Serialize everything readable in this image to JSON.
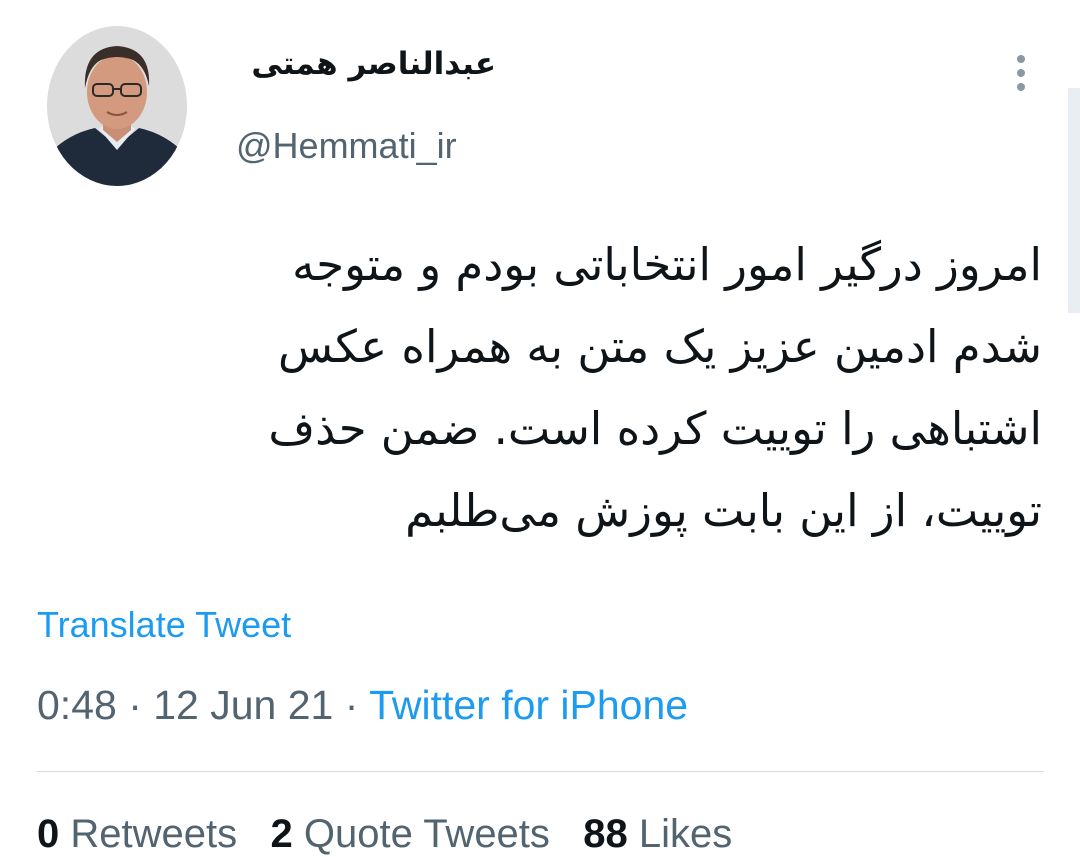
{
  "user": {
    "display_name": "عبدالناصر همتی",
    "handle": "@Hemmati_ir",
    "avatar_icon": "profile-photo"
  },
  "more_icon": "vertical-ellipsis-icon",
  "tweet": {
    "lines": [
      "امروز درگیر امور انتخاباتی بودم و متوجه",
      "شدم ادمین عزیز یک متن به همراه عکس",
      "اشتباهی را توییت کرده است. ضمن حذف",
      "توییت، از این بابت پوزش می‌طلبم"
    ]
  },
  "translate_label": "Translate Tweet",
  "meta": {
    "time": "0:48",
    "date": "12 Jun 21",
    "separator": " · ",
    "source": "Twitter for iPhone"
  },
  "stats": {
    "retweets_count": "0",
    "retweets_label": "Retweets",
    "quote_count": "2",
    "quote_label": "Quote Tweets",
    "likes_count": "88",
    "likes_label": "Likes"
  },
  "colors": {
    "link": "#1d9bf0",
    "secondary": "#536471",
    "text": "#0f1419"
  }
}
